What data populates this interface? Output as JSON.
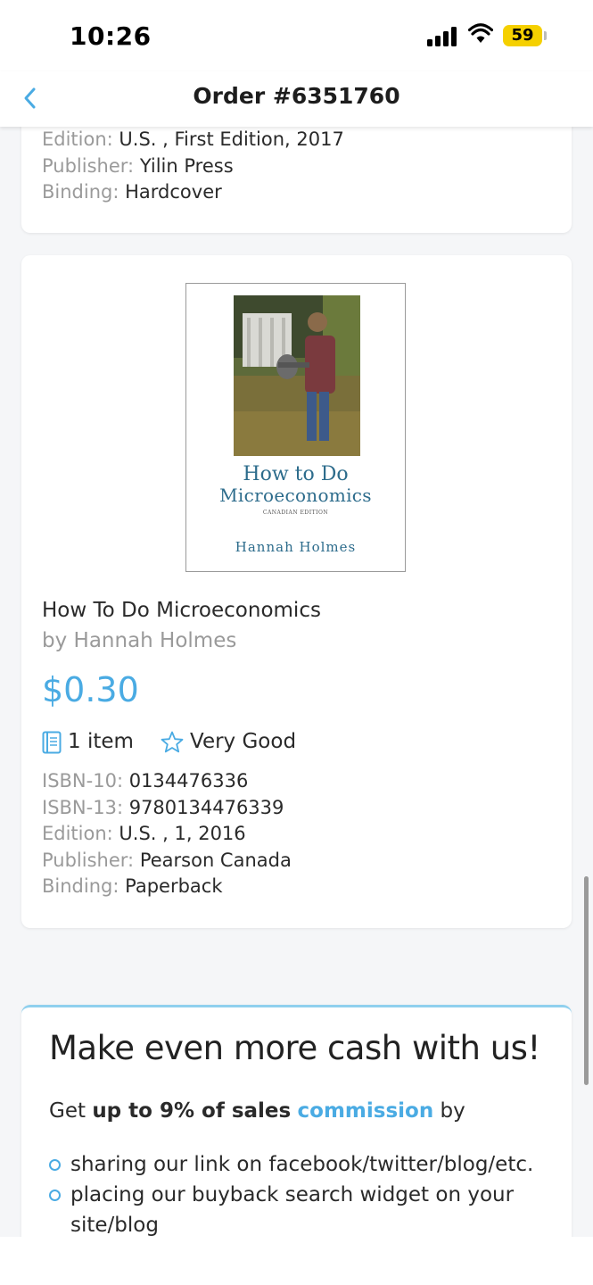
{
  "status_bar": {
    "time": "10:26",
    "battery": "59"
  },
  "nav": {
    "title": "Order #6351760"
  },
  "previous_item": {
    "edition_label": "Edition:",
    "edition_value": "U.S. , First Edition, 2017",
    "publisher_label": "Publisher:",
    "publisher_value": "Yilin Press",
    "binding_label": "Binding:",
    "binding_value": "Hardcover"
  },
  "item": {
    "cover": {
      "title_line1": "How to Do",
      "title_line2": "Microeconomics",
      "edition_text": "CANADIAN EDITION",
      "author": "Hannah Holmes"
    },
    "title": "How To Do Microeconomics",
    "author": "by Hannah Holmes",
    "price": "$0.30",
    "quantity": "1 item",
    "condition": "Very Good",
    "isbn10_label": "ISBN-10:",
    "isbn10_value": "0134476336",
    "isbn13_label": "ISBN-13:",
    "isbn13_value": "9780134476339",
    "edition_label": "Edition:",
    "edition_value": "U.S. , 1, 2016",
    "publisher_label": "Publisher:",
    "publisher_value": "Pearson Canada",
    "binding_label": "Binding:",
    "binding_value": "Paperback"
  },
  "promo": {
    "title": "Make even more cash with us!",
    "text_get": "Get",
    "text_bold": "up to 9% of sales",
    "text_link": "commission",
    "text_by": "by",
    "bullet1": "sharing our link on facebook/twitter/blog/etc.",
    "bullet2_line1": "placing our buyback search widget on your",
    "bullet2_line2": "site/blog"
  },
  "colors": {
    "accent": "#4aabe3",
    "cover_text": "#2d6c8c"
  }
}
